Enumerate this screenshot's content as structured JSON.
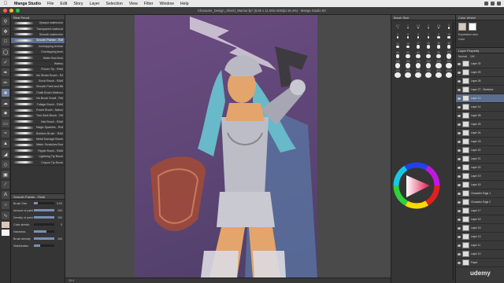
{
  "menubar": {
    "app": "Manga Studio",
    "items": [
      "File",
      "Edit",
      "Story",
      "Layer",
      "Selection",
      "View",
      "Filter",
      "Window",
      "Help"
    ]
  },
  "titlebar": {
    "title": "Character_Design_Shield_Warrior.lip* (8.60 x 11.00in 600dpi 19.4%) - Manga Studio 5X"
  },
  "subtool": {
    "header": "Real Pencil",
    "brushes": [
      "Opaque watercolor",
      "Transparent watercolor",
      "Smooth watercolor",
      "Smooth Painter - RAM",
      "Overlapping texture",
      "Overlapping lines",
      "Water flow lines",
      "Watery",
      "Flower Tip - RAM",
      "Ink Stroke Brush - RAM",
      "Scrub Brush - RAM",
      "Smooth Paint and Blend Brush",
      "Chalk Brush Watercolor",
      "Ink Brush Small - RAM",
      "Foliage Brush - RAM",
      "Power Brush - Natural - RAM",
      "Tree Bark Brush - RAM",
      "Hair Brush - RAM",
      "Magic Sparkles - RAM",
      "Bubbles Brush - RAM",
      "Metal Damage Brush - RAM",
      "Water Scratches Brush - RAM",
      "Ripple Brush - RAM",
      "Lightning Tip Brush",
      "Crayon Tip Brush"
    ]
  },
  "toolprop": {
    "header": "Smooth Painter - RAM",
    "rows": [
      {
        "label": "Brush Size",
        "value": "5.00",
        "fill": 0.2
      },
      {
        "label": "Amount of paint",
        "value": "100",
        "fill": 1.0
      },
      {
        "label": "Density of paint",
        "value": "100",
        "fill": 1.0
      },
      {
        "label": "Color stretch",
        "value": "0",
        "fill": 0.0
      },
      {
        "label": "Hardness",
        "value": "",
        "fill": 0.6
      },
      {
        "label": "Brush density",
        "value": "100",
        "fill": 1.0
      },
      {
        "label": "Stabilization",
        "value": "",
        "fill": 0.3
      }
    ]
  },
  "canvas": {
    "status": "19.4"
  },
  "brushsize": {
    "header": "Brush Size",
    "sizes": [
      "0.7",
      "1",
      "1.5",
      "2",
      "2.5",
      "3",
      "4",
      "5",
      "6",
      "7",
      "8",
      "10",
      "12",
      "15",
      "17",
      "20",
      "25",
      "30",
      "40",
      "50",
      "60",
      "70",
      "80",
      "100",
      "120",
      "150",
      "170",
      "200",
      "250",
      "300",
      "400",
      "500",
      "600",
      "700",
      "800",
      "1000"
    ]
  },
  "colorpanel": {
    "header": "Color Wheel",
    "expression": "Expression color",
    "mode": "Color"
  },
  "layerpanel": {
    "header": "Layer Property",
    "blend": "Normal",
    "opacity": "100",
    "layers": [
      "Layer 30",
      "Layer 29",
      "Layer 28",
      "Layer 27 - Sketches",
      "Layer 12",
      "Layer 14",
      "Layer 28",
      "Layer 25",
      "Layer 24",
      "Layer 23",
      "Layer 22",
      "Layer 21",
      "Layer 20",
      "Layer 19",
      "Layer 18",
      "Character Edge 1",
      "Character Edge 2",
      "Layer 17",
      "Layer 16",
      "Layer 15",
      "Layer 13",
      "Layer 11",
      "Layer 10",
      "Paper"
    ]
  },
  "watermark": "udemy",
  "colors": {
    "selection": "#5b6e8f",
    "canvas_bg": "#6c4c82"
  }
}
